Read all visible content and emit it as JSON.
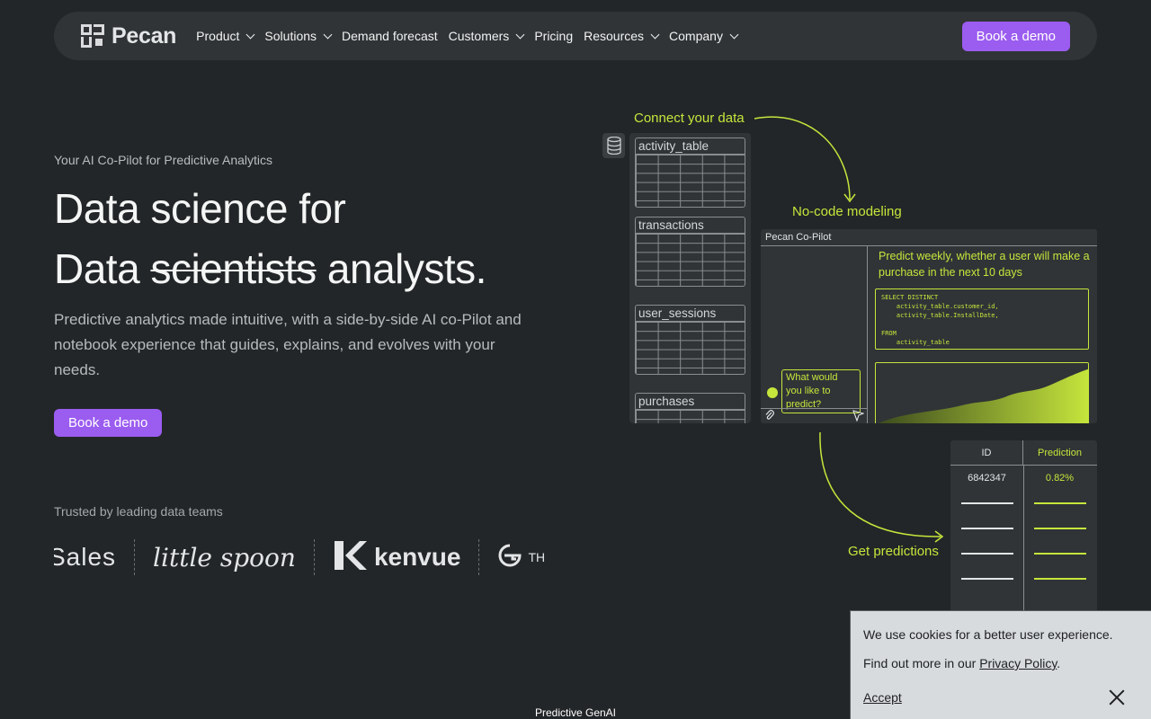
{
  "brand": {
    "name": "Pecan"
  },
  "nav": {
    "items": [
      {
        "label": "Product",
        "dropdown": true
      },
      {
        "label": "Solutions",
        "dropdown": true
      },
      {
        "label": "Demand forecast",
        "dropdown": false
      },
      {
        "label": "Customers",
        "dropdown": true
      },
      {
        "label": "Pricing",
        "dropdown": false
      },
      {
        "label": "Resources",
        "dropdown": true
      },
      {
        "label": "Company",
        "dropdown": true
      }
    ],
    "cta": "Book a demo"
  },
  "hero": {
    "eyebrow": "Your AI Co-Pilot for Predictive Analytics",
    "title_line1": "Data science for",
    "title_line2_prefix": "Data",
    "title_line2_struck": "scientists",
    "title_line2_suffix": "analysts.",
    "subtitle": "Predictive analytics made intuitive, with a side-by-side AI co-Pilot and notebook experience that guides, explains, and evolves with your needs.",
    "cta": "Book a demo"
  },
  "trusted": {
    "label": "Trusted by leading data teams",
    "logos": [
      "Sales",
      "little spoon",
      "kenvue",
      "TH"
    ]
  },
  "illustration": {
    "connect_label": "Connect your data",
    "modeling_label": "No-code modeling",
    "predictions_label": "Get predictions",
    "tables": [
      "activity_table",
      "transactions",
      "user_sessions",
      "purchases"
    ],
    "copilot": {
      "title": "Pecan Co-Pilot",
      "prompt": "Predict weekly, whether a user will make a purchase in the next 10 days",
      "sql": "SELECT DISTINCT\n    activity_table.customer_id,\n    activity_table.InstallDate,\n\nFROM\n    activity_table",
      "question": "What would you like to predict?"
    },
    "predictions_table": {
      "headers": [
        "ID",
        "Prediction"
      ],
      "first_row": [
        "6842347",
        "0.82%"
      ]
    }
  },
  "footer": {
    "label": "Predictive GenAI"
  },
  "cookie": {
    "line1": "We use cookies for a better user experience.",
    "line2_prefix": "Find out more in our",
    "privacy_link": "Privacy Policy",
    "line2_suffix": ".",
    "accept": "Accept"
  },
  "colors": {
    "background": "#232628",
    "nav_bg": "#303436",
    "accent_purple": "#9b5cf0",
    "accent_lime": "#c6e63c"
  }
}
